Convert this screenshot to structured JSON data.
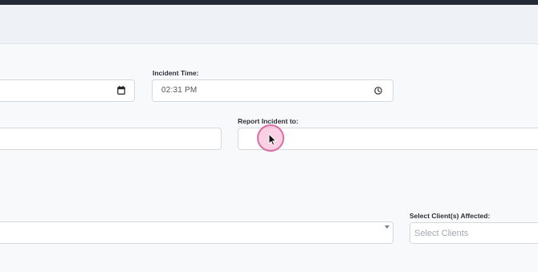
{
  "form": {
    "incident_time": {
      "label": "Incident Time:",
      "value": "02:31 PM"
    },
    "report_incident_to": {
      "label": "Report Incident to:",
      "value": ""
    },
    "clients_affected": {
      "label": "Select Client(s) Affected:",
      "placeholder": "Select Clients"
    }
  },
  "icons": {
    "date": "calendar-icon",
    "time": "clock-icon",
    "dropdown": "caret-down-icon",
    "pointer": "mouse-pointer-icon"
  },
  "colors": {
    "top_bar": "#252a37",
    "header_band": "#eef2f7",
    "cursor_highlight": "#d65a96"
  }
}
